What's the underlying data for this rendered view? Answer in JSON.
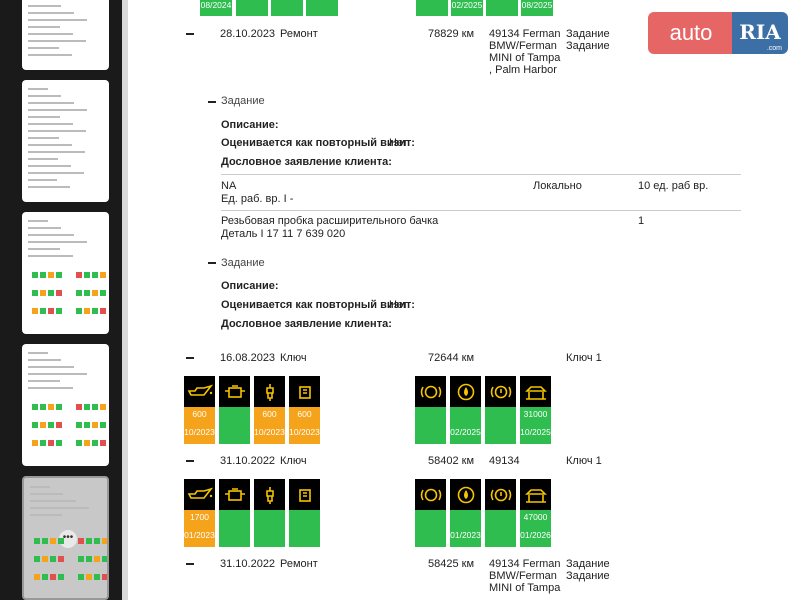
{
  "logo": {
    "auto": "auto",
    "ria": "RIA",
    "com": ".com"
  },
  "top_icons": {
    "left_date": "08/2024",
    "right1_date": "02/2025",
    "right2_date": "08/2025"
  },
  "entry1": {
    "date": "28.10.2023",
    "type": "Ремонт",
    "mileage": "78829 км",
    "dealer": [
      "49134 Ferman",
      "BMW/Ferman",
      "MINI of Tampa",
      ", Palm Harbor"
    ],
    "status": [
      "Задание",
      "Задание"
    ]
  },
  "task1": {
    "title": "Задание",
    "description_label": "Описание:",
    "repeat_label": "Оценивается как повторный визит:",
    "repeat_value": "Нет",
    "statement_label": "Дословное заявление клиента:",
    "row1": {
      "name": "NA",
      "sub": "Ед. раб. вр. I -",
      "location": "Локально",
      "qty": "10 ед. раб вр."
    },
    "row2": {
      "name": "Резьбовая пробка расширительного бачка",
      "sub": "Деталь I 17 11 7 639 020",
      "qty": "1"
    }
  },
  "task2": {
    "title": "Задание",
    "description_label": "Описание:",
    "repeat_label": "Оценивается как повторный визит:",
    "repeat_value": "Нет",
    "statement_label": "Дословное заявление клиента:"
  },
  "entry2": {
    "date": "16.08.2023",
    "type": "Ключ",
    "mileage": "72644 км",
    "status": "Ключ 1",
    "icons_left": [
      {
        "icon": "oil-can-icon",
        "color": "orange",
        "value": "600",
        "date": "10/2023"
      },
      {
        "icon": "engine-filter-icon",
        "color": "green",
        "value": "",
        "date": ""
      },
      {
        "icon": "spark-plug-icon",
        "color": "orange",
        "value": "600",
        "date": "10/2023"
      },
      {
        "icon": "fuel-filter-icon",
        "color": "orange",
        "value": "600",
        "date": "10/2023"
      }
    ],
    "icons_right": [
      {
        "icon": "brake-front-icon",
        "color": "green",
        "value": "",
        "date": ""
      },
      {
        "icon": "brake-fluid-icon",
        "color": "green",
        "value": "",
        "date": "02/2025"
      },
      {
        "icon": "brake-rear-icon",
        "color": "green",
        "value": "",
        "date": ""
      },
      {
        "icon": "car-lift-icon",
        "color": "green",
        "value": "31000",
        "date": "10/2025"
      }
    ]
  },
  "entry3": {
    "date": "31.10.2022",
    "type": "Ключ",
    "mileage": "58402 км",
    "dealer": "49134",
    "status": "Ключ 1",
    "icons_left": [
      {
        "icon": "oil-can-icon",
        "color": "orange",
        "value": "1700",
        "date": "01/2023"
      },
      {
        "icon": "engine-filter-icon",
        "color": "green",
        "value": "",
        "date": ""
      },
      {
        "icon": "spark-plug-icon",
        "color": "green",
        "value": "",
        "date": ""
      },
      {
        "icon": "fuel-filter-icon",
        "color": "green",
        "value": "",
        "date": ""
      }
    ],
    "icons_right": [
      {
        "icon": "brake-front-icon",
        "color": "green",
        "value": "",
        "date": ""
      },
      {
        "icon": "brake-fluid-icon",
        "color": "green",
        "value": "",
        "date": "01/2023"
      },
      {
        "icon": "brake-rear-icon",
        "color": "green",
        "value": "",
        "date": ""
      },
      {
        "icon": "car-lift-icon",
        "color": "green",
        "value": "47000",
        "date": "01/2026"
      }
    ]
  },
  "entry4": {
    "date": "31.10.2022",
    "type": "Ремонт",
    "mileage": "58425 км",
    "dealer": [
      "49134 Ferman",
      "BMW/Ferman",
      "MINI of Tampa"
    ],
    "status": [
      "Задание",
      "Задание"
    ]
  },
  "colors": {
    "green": "#2ebd4e",
    "orange": "#f4a31a",
    "icon_symbol": "#f5c400"
  }
}
